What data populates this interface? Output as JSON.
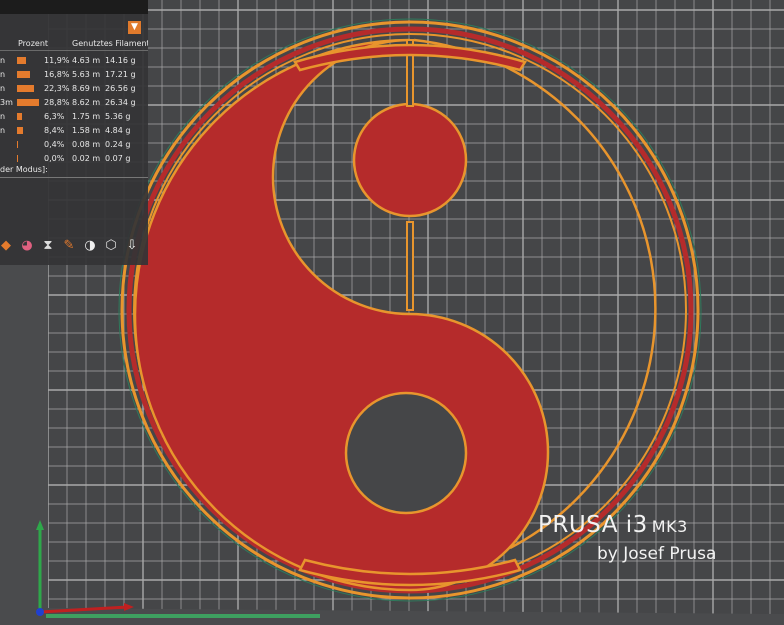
{
  "legend": {
    "columns": {
      "percent": "Prozent",
      "filament": "Genutztes Filament"
    },
    "rows": [
      {
        "label": "n",
        "percent": "11,9%",
        "percent_value": 11.9,
        "length": "4.63 m",
        "weight": "14.16 g"
      },
      {
        "label": "n",
        "percent": "16,8%",
        "percent_value": 16.8,
        "length": "5.63 m",
        "weight": "17.21 g"
      },
      {
        "label": "n",
        "percent": "22,3%",
        "percent_value": 22.3,
        "length": "8.69 m",
        "weight": "26.56 g"
      },
      {
        "label": "3m",
        "percent": "28,8%",
        "percent_value": 28.8,
        "length": "8.62 m",
        "weight": "26.34 g"
      },
      {
        "label": "n",
        "percent": "6,3%",
        "percent_value": 6.3,
        "length": "1.75 m",
        "weight": "5.36 g"
      },
      {
        "label": "n",
        "percent": "8,4%",
        "percent_value": 8.4,
        "length": "1.58 m",
        "weight": "4.84 g"
      },
      {
        "label": "",
        "percent": "0,4%",
        "percent_value": 0.4,
        "length": "0.08 m",
        "weight": "0.24 g"
      },
      {
        "label": "",
        "percent": "0,0%",
        "percent_value": 0.0,
        "length": "0.02 m",
        "weight": "0.07 g"
      }
    ],
    "mode_label": "der Modus]:",
    "toggle_icon": "▼"
  },
  "toolbar": {
    "icons": [
      "layers-icon",
      "color-icon",
      "hourglass-icon",
      "edit-icon",
      "checker-icon",
      "cube-icon",
      "export-icon"
    ]
  },
  "bed_logo": {
    "line1": "PRUSA i3",
    "line1_suffix": "MK3",
    "line2": "by Josef Prusa"
  },
  "colors": {
    "print": "#b52b2b",
    "perimeter": "#e8952d",
    "bed": "#454648",
    "grid": "#a9a9a9",
    "accent": "#e47b2d"
  }
}
